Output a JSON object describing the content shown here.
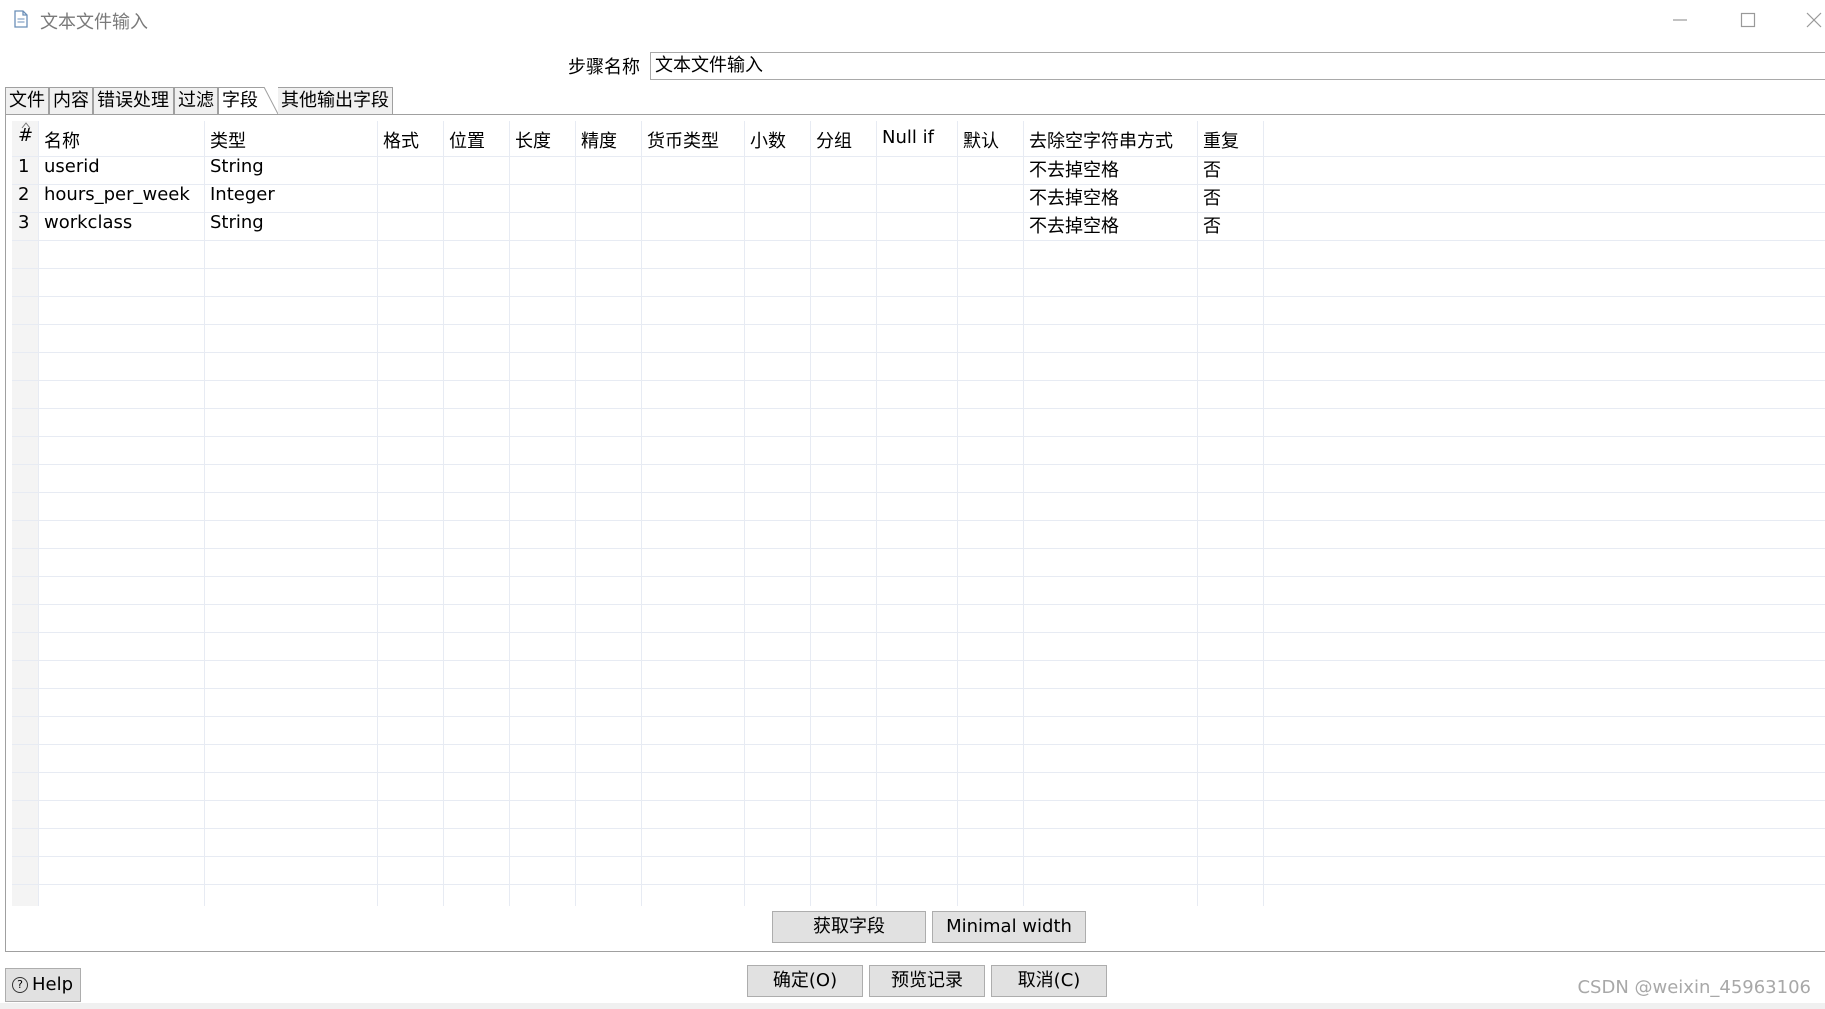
{
  "window": {
    "title": "文本文件输入",
    "controls": [
      "minimize-icon",
      "maximize-icon",
      "close-icon"
    ]
  },
  "step": {
    "label": "步骤名称",
    "value": "文本文件输入"
  },
  "tabs": [
    {
      "label": "文件"
    },
    {
      "label": "内容"
    },
    {
      "label": "错误处理"
    },
    {
      "label": "过滤"
    },
    {
      "label": "字段",
      "active": true
    },
    {
      "label": "其他输出字段"
    }
  ],
  "table": {
    "columns": [
      "#",
      "名称",
      "类型",
      "格式",
      "位置",
      "长度",
      "精度",
      "货币类型",
      "小数",
      "分组",
      "Null if",
      "默认",
      "去除空字符串方式",
      "重复"
    ],
    "rows": [
      {
        "num": "1",
        "name": "userid",
        "type": "String",
        "trim": "不去掉空格",
        "repeat": "否"
      },
      {
        "num": "2",
        "name": "hours_per_week",
        "type": "Integer",
        "trim": "不去掉空格",
        "repeat": "否"
      },
      {
        "num": "3",
        "name": "workclass",
        "type": "String",
        "trim": "不去掉空格",
        "repeat": "否"
      }
    ]
  },
  "buttons": {
    "get_fields": "获取字段",
    "minimal_width": "Minimal width",
    "ok": "确定(O)",
    "preview": "预览记录",
    "cancel": "取消(C)",
    "help": "Help"
  },
  "watermark": "CSDN @weixin_45963106"
}
